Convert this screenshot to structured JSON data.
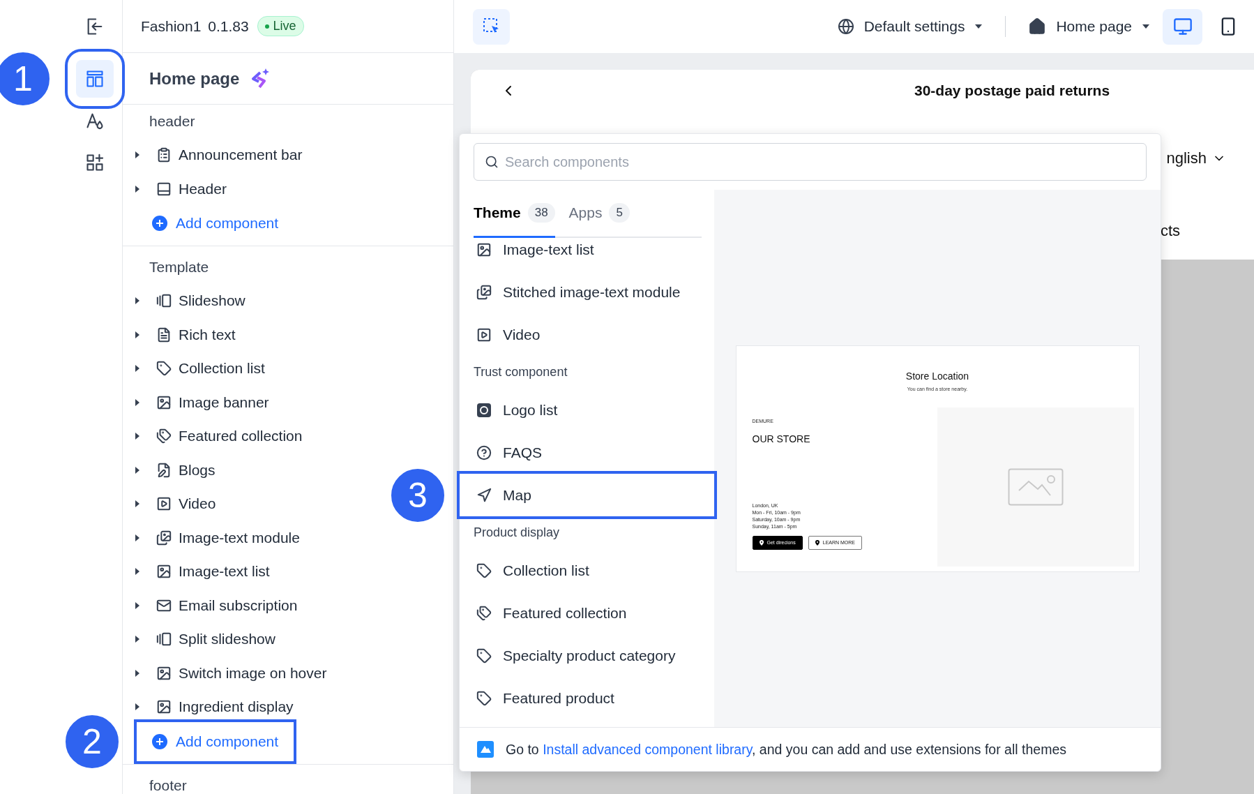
{
  "rail": {
    "items": [
      {
        "kind": "exit",
        "selected": false
      },
      {
        "kind": "layout",
        "selected": true,
        "marker": "1"
      },
      {
        "kind": "style",
        "selected": false
      },
      {
        "kind": "apps",
        "selected": false
      }
    ]
  },
  "panel": {
    "store": "Fashion1 0.1.83",
    "status": "Live",
    "page_title": "Home page",
    "groups": [
      {
        "label": "header",
        "items": [
          {
            "label": "Announcement bar",
            "kind": "clipboard",
            "expanded": false
          },
          {
            "label": "Header",
            "kind": "panel",
            "expanded": false
          }
        ],
        "add_button": {
          "label": "Add component"
        }
      },
      {
        "label": "Template",
        "items": [
          {
            "label": "Slideshow",
            "kind": "gallery",
            "expanded": false
          },
          {
            "label": "Rich text",
            "kind": "text",
            "expanded": false
          },
          {
            "label": "Collection list",
            "kind": "tag",
            "expanded": false
          },
          {
            "label": "Image banner",
            "kind": "image",
            "expanded": false
          },
          {
            "label": "Featured collection",
            "kind": "tags",
            "expanded": false
          },
          {
            "label": "Blogs",
            "kind": "blog",
            "expanded": false
          },
          {
            "label": "Video",
            "kind": "video",
            "expanded": false
          },
          {
            "label": "Image-text module",
            "kind": "images",
            "expanded": false
          },
          {
            "label": "Image-text list",
            "kind": "image",
            "expanded": false
          },
          {
            "label": "Email subscription",
            "kind": "mail",
            "expanded": false
          },
          {
            "label": "Split slideshow",
            "kind": "gallery",
            "expanded": false
          },
          {
            "label": "Switch image on hover",
            "kind": "image",
            "expanded": false
          },
          {
            "label": "Ingredient display",
            "kind": "image",
            "expanded": false
          }
        ],
        "add_button": {
          "label": "Add component",
          "marker": "2"
        }
      },
      {
        "label": "footer"
      }
    ]
  },
  "toolbar": {
    "selectors": [
      {
        "kind": "globe",
        "label": "Default settings"
      },
      {
        "kind": "house",
        "label": "Home page"
      }
    ],
    "devices": [
      {
        "kind": "desktop",
        "selected": true
      },
      {
        "kind": "mobile",
        "selected": false
      }
    ]
  },
  "site_preview": {
    "announcement": "30-day postage paid returns",
    "language": "nglish",
    "nav_item": "cts"
  },
  "component_picker": {
    "search": {
      "placeholder": "Search components"
    },
    "tabs": [
      {
        "label": "Theme",
        "count": "38",
        "selected": true
      },
      {
        "label": "Apps",
        "count": "5",
        "selected": false
      }
    ],
    "entries": [
      {
        "kind": "image",
        "label": "Image-text list"
      },
      {
        "kind": "images",
        "label": "Stitched image-text module"
      },
      {
        "kind": "video",
        "label": "Video"
      },
      {
        "kind": "heading",
        "label": "Trust component"
      },
      {
        "kind": "badge",
        "label": "Logo list"
      },
      {
        "kind": "help",
        "label": "FAQS"
      },
      {
        "kind": "map",
        "label": "Map",
        "marker": "3"
      },
      {
        "kind": "heading",
        "label": "Product display"
      },
      {
        "kind": "tag",
        "label": "Collection list"
      },
      {
        "kind": "tags",
        "label": "Featured collection"
      },
      {
        "kind": "tag",
        "label": "Specialty product category"
      },
      {
        "kind": "tag",
        "label": "Featured product"
      }
    ],
    "preview": {
      "title": "Store Location",
      "subtitle": "You can find a store nearby.",
      "eyebrow": "DEMURE",
      "heading": "OUR STORE",
      "lines": [
        "London, UK",
        "Mon - Fri, 10am - 9pm",
        "Saturday, 10am - 9pm",
        "Sunday, 11am - 5pm"
      ],
      "buttons": [
        {
          "label": "Get direcions",
          "kind": "primary"
        },
        {
          "label": "LEARN MORE",
          "kind": "secondary"
        }
      ]
    },
    "footer": {
      "before": "Go to ",
      "link": "Install advanced component library",
      "after": ", and you can add and use extensions for all themes"
    }
  }
}
